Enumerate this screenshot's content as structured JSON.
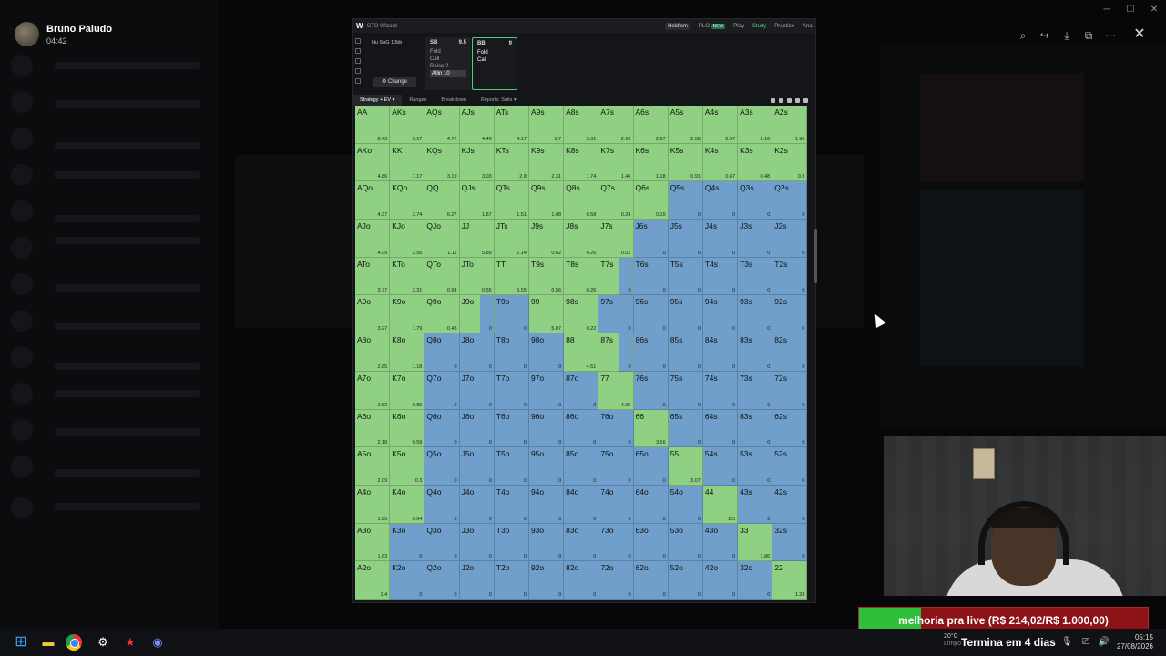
{
  "viewer": {
    "user_name": "Bruno Paludo",
    "time": "04:42"
  },
  "gto": {
    "logo": "W",
    "brand": "GTO Wizard",
    "nav": {
      "holdem": "Hold'em",
      "plo": "PLO",
      "plo_badge": "NEW",
      "play": "Play",
      "study": "Study",
      "practice": "Practice",
      "analyze": "Anal"
    },
    "game_label": "Hu SnG  10bb",
    "change_button": "⚙ Change",
    "positions": [
      {
        "pos": "SB",
        "stack": "9.5",
        "actions": [
          "Fold",
          "Call",
          "Raise 2",
          "Allin 10"
        ],
        "highlight": "Allin 10"
      },
      {
        "pos": "BB",
        "stack": "9",
        "actions": [
          "Fold",
          "Call"
        ],
        "highlight": ""
      }
    ],
    "tabs": [
      "Strategy + EV ▾",
      "Ranges",
      "Breakdown",
      "Reports: Suits ▾"
    ]
  },
  "matrix": {
    "colors": {
      "fold": "#6f9fca",
      "call": "#8fd083"
    },
    "cells": [
      [
        "AA",
        "8.43",
        "c"
      ],
      [
        "AKs",
        "5.17",
        "c"
      ],
      [
        "AQs",
        "4.72",
        "c"
      ],
      [
        "AJs",
        "4.46",
        "c"
      ],
      [
        "ATs",
        "4.17",
        "c"
      ],
      [
        "A9s",
        "3.7",
        "c"
      ],
      [
        "A8s",
        "3.31",
        "c"
      ],
      [
        "A7s",
        "2.99",
        "c"
      ],
      [
        "A6s",
        "2.67",
        "c"
      ],
      [
        "A5s",
        "2.58",
        "c"
      ],
      [
        "A4s",
        "2.37",
        "c"
      ],
      [
        "A3s",
        "2.16",
        "c"
      ],
      [
        "A2s",
        "1.95",
        "c"
      ],
      [
        "AKo",
        "4.86",
        "c"
      ],
      [
        "KK",
        "7.17",
        "c"
      ],
      [
        "KQs",
        "3.19",
        "c"
      ],
      [
        "KJs",
        "3.03",
        "c"
      ],
      [
        "KTs",
        "2.8",
        "c"
      ],
      [
        "K9s",
        "2.31",
        "c"
      ],
      [
        "K8s",
        "1.74",
        "c"
      ],
      [
        "K7s",
        "1.46",
        "c"
      ],
      [
        "K6s",
        "1.18",
        "c"
      ],
      [
        "K5s",
        "0.91",
        "c"
      ],
      [
        "K4s",
        "0.67",
        "c"
      ],
      [
        "K3s",
        "0.48",
        "c"
      ],
      [
        "K2s",
        "0.3",
        "c"
      ],
      [
        "AQo",
        "4.37",
        "c"
      ],
      [
        "KQo",
        "2.74",
        "c"
      ],
      [
        "QQ",
        "6.27",
        "c"
      ],
      [
        "QJs",
        "1.67",
        "c"
      ],
      [
        "QTs",
        "1.51",
        "c"
      ],
      [
        "Q9s",
        "1.08",
        "c"
      ],
      [
        "Q8s",
        "0.58",
        "c"
      ],
      [
        "Q7s",
        "0.24",
        "c"
      ],
      [
        "Q6s",
        "0.15",
        "c"
      ],
      [
        "Q5s",
        "0",
        "f"
      ],
      [
        "Q4s",
        "0",
        "f"
      ],
      [
        "Q3s",
        "0",
        "f"
      ],
      [
        "Q2s",
        "0",
        "f"
      ],
      [
        "AJo",
        "4.09",
        "c"
      ],
      [
        "KJo",
        "2.56",
        "c"
      ],
      [
        "QJo",
        "1.11",
        "c"
      ],
      [
        "JJ",
        "5.89",
        "c"
      ],
      [
        "JTs",
        "1.14",
        "c"
      ],
      [
        "J9s",
        "0.62",
        "c"
      ],
      [
        "J8s",
        "0.26",
        "c"
      ],
      [
        "J7s",
        "0.01",
        "c"
      ],
      [
        "J6s",
        "0",
        "f"
      ],
      [
        "J5s",
        "0",
        "f"
      ],
      [
        "J4s",
        "0",
        "f"
      ],
      [
        "J3s",
        "0",
        "f"
      ],
      [
        "J2s",
        "0",
        "f"
      ],
      [
        "ATo",
        "3.77",
        "c"
      ],
      [
        "KTo",
        "2.31",
        "c"
      ],
      [
        "QTo",
        "0.94",
        "c"
      ],
      [
        "JTo",
        "0.55",
        "c"
      ],
      [
        "TT",
        "5.55",
        "c"
      ],
      [
        "T9s",
        "0.56",
        "c"
      ],
      [
        "T8s",
        "0.26",
        "c"
      ],
      [
        "T7s",
        "0",
        "m"
      ],
      [
        "T6s",
        "0",
        "f"
      ],
      [
        "T5s",
        "0",
        "f"
      ],
      [
        "T4s",
        "0",
        "f"
      ],
      [
        "T3s",
        "0",
        "f"
      ],
      [
        "T2s",
        "0",
        "f"
      ],
      [
        "A9o",
        "3.27",
        "c"
      ],
      [
        "K9o",
        "1.79",
        "c"
      ],
      [
        "Q9o",
        "0.48",
        "c"
      ],
      [
        "J9o",
        "0",
        "m"
      ],
      [
        "T9o",
        "0",
        "f"
      ],
      [
        "99",
        "5.07",
        "c"
      ],
      [
        "98s",
        "0.22",
        "c"
      ],
      [
        "97s",
        "0",
        "f"
      ],
      [
        "96s",
        "0",
        "f"
      ],
      [
        "95s",
        "0",
        "f"
      ],
      [
        "94s",
        "0",
        "f"
      ],
      [
        "93s",
        "0",
        "f"
      ],
      [
        "92s",
        "0",
        "f"
      ],
      [
        "A8o",
        "2.85",
        "c"
      ],
      [
        "K8o",
        "1.18",
        "c"
      ],
      [
        "Q8o",
        "0",
        "f"
      ],
      [
        "J8o",
        "0",
        "f"
      ],
      [
        "T8o",
        "0",
        "f"
      ],
      [
        "98o",
        "0",
        "f"
      ],
      [
        "88",
        "4.51",
        "c"
      ],
      [
        "87s",
        "0",
        "m"
      ],
      [
        "86s",
        "0",
        "f"
      ],
      [
        "85s",
        "0",
        "f"
      ],
      [
        "84s",
        "0",
        "f"
      ],
      [
        "83s",
        "0",
        "f"
      ],
      [
        "82s",
        "0",
        "f"
      ],
      [
        "A7o",
        "2.52",
        "c"
      ],
      [
        "K7o",
        "0.89",
        "c"
      ],
      [
        "Q7o",
        "0",
        "f"
      ],
      [
        "J7o",
        "0",
        "f"
      ],
      [
        "T7o",
        "0",
        "f"
      ],
      [
        "97o",
        "0",
        "f"
      ],
      [
        "87o",
        "0",
        "f"
      ],
      [
        "77",
        "4.05",
        "c"
      ],
      [
        "76s",
        "0",
        "f"
      ],
      [
        "75s",
        "0",
        "f"
      ],
      [
        "74s",
        "0",
        "f"
      ],
      [
        "73s",
        "0",
        "f"
      ],
      [
        "72s",
        "0",
        "f"
      ],
      [
        "A6o",
        "2.18",
        "c"
      ],
      [
        "K6o",
        "0.59",
        "c"
      ],
      [
        "Q6o",
        "0",
        "f"
      ],
      [
        "J6o",
        "0",
        "f"
      ],
      [
        "T6o",
        "0",
        "f"
      ],
      [
        "96o",
        "0",
        "f"
      ],
      [
        "86o",
        "0",
        "f"
      ],
      [
        "76o",
        "0",
        "f"
      ],
      [
        "66",
        "3.56",
        "c"
      ],
      [
        "65s",
        "0",
        "f"
      ],
      [
        "64s",
        "0",
        "f"
      ],
      [
        "63s",
        "0",
        "f"
      ],
      [
        "62s",
        "0",
        "f"
      ],
      [
        "A5o",
        "2.09",
        "c"
      ],
      [
        "K5o",
        "0.3",
        "c"
      ],
      [
        "Q5o",
        "0",
        "f"
      ],
      [
        "J5o",
        "0",
        "f"
      ],
      [
        "T5o",
        "0",
        "f"
      ],
      [
        "95o",
        "0",
        "f"
      ],
      [
        "85o",
        "0",
        "f"
      ],
      [
        "75o",
        "0",
        "f"
      ],
      [
        "65o",
        "0",
        "f"
      ],
      [
        "55",
        "3.07",
        "c"
      ],
      [
        "54s",
        "0",
        "f"
      ],
      [
        "53s",
        "0",
        "f"
      ],
      [
        "52s",
        "0",
        "f"
      ],
      [
        "A4o",
        "1.85",
        "c"
      ],
      [
        "K4o",
        "0.04",
        "c"
      ],
      [
        "Q4o",
        "0",
        "f"
      ],
      [
        "J4o",
        "0",
        "f"
      ],
      [
        "T4o",
        "0",
        "f"
      ],
      [
        "94o",
        "0",
        "f"
      ],
      [
        "84o",
        "0",
        "f"
      ],
      [
        "74o",
        "0",
        "f"
      ],
      [
        "64o",
        "0",
        "f"
      ],
      [
        "54o",
        "0",
        "f"
      ],
      [
        "44",
        "2.5",
        "c"
      ],
      [
        "43s",
        "0",
        "f"
      ],
      [
        "42s",
        "0",
        "f"
      ],
      [
        "A3o",
        "1.63",
        "c"
      ],
      [
        "K3o",
        "0",
        "f"
      ],
      [
        "Q3o",
        "0",
        "f"
      ],
      [
        "J3o",
        "0",
        "f"
      ],
      [
        "T3o",
        "0",
        "f"
      ],
      [
        "93o",
        "0",
        "f"
      ],
      [
        "83o",
        "0",
        "f"
      ],
      [
        "73o",
        "0",
        "f"
      ],
      [
        "63o",
        "0",
        "f"
      ],
      [
        "53o",
        "0",
        "f"
      ],
      [
        "43o",
        "0",
        "f"
      ],
      [
        "33",
        "1.86",
        "c"
      ],
      [
        "32s",
        "0",
        "f"
      ],
      [
        "A2o",
        "1.4",
        "c"
      ],
      [
        "K2o",
        "0",
        "f"
      ],
      [
        "Q2o",
        "0",
        "f"
      ],
      [
        "J2o",
        "0",
        "f"
      ],
      [
        "T2o",
        "0",
        "f"
      ],
      [
        "92o",
        "0",
        "f"
      ],
      [
        "82o",
        "0",
        "f"
      ],
      [
        "72o",
        "0",
        "f"
      ],
      [
        "62o",
        "0",
        "f"
      ],
      [
        "52o",
        "0",
        "f"
      ],
      [
        "42o",
        "0",
        "f"
      ],
      [
        "32o",
        "0",
        "f"
      ],
      [
        "22",
        "1.28",
        "c"
      ]
    ]
  },
  "goal": {
    "text": "melhoria pra live (R$ 214,02/R$ 1.000,00)",
    "progress": 0.214
  },
  "taskbar": {
    "weather": "20°C",
    "weather_sub": "Limpo",
    "notification": "Termina em 4 dias",
    "time": "05:15",
    "date": "27/08/2026"
  }
}
